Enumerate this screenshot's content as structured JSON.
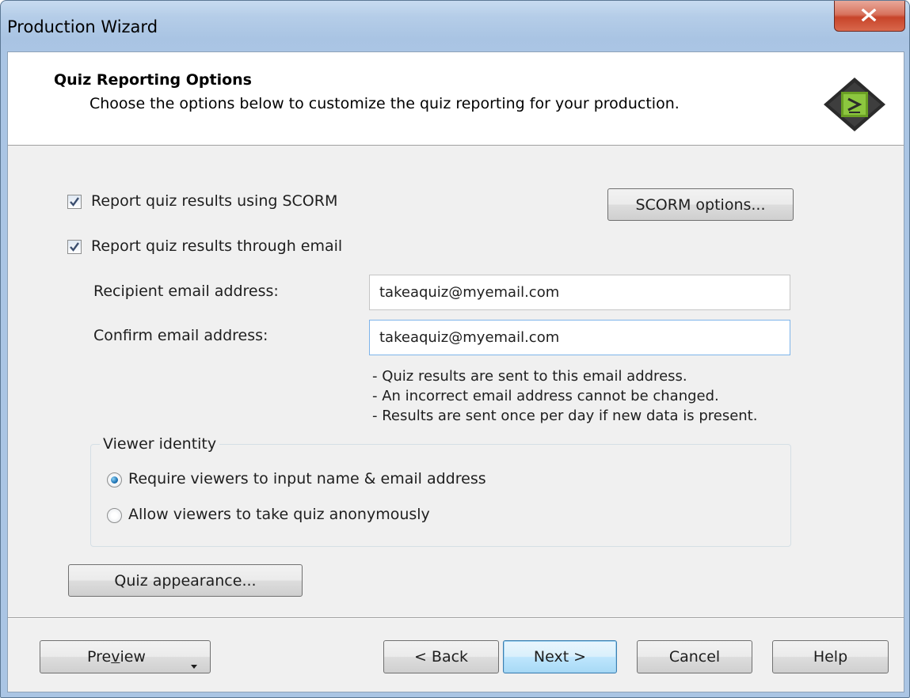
{
  "window": {
    "title": "Production Wizard"
  },
  "header": {
    "title": "Quiz Reporting Options",
    "subtitle": "Choose the options below to customize the quiz reporting for your production.",
    "logo_icon": "camtasia-logo-icon"
  },
  "scorm": {
    "label": "Report quiz results using SCORM",
    "checked": true,
    "options_button": "SCORM options..."
  },
  "email": {
    "label": "Report quiz results through email",
    "checked": true,
    "recipient_label": "Recipient email address:",
    "recipient_value": "takeaquiz@myemail.com",
    "confirm_label": "Confirm email address:",
    "confirm_value": "takeaquiz@myemail.com",
    "notes": [
      "- Quiz results are sent to this email address.",
      "- An incorrect email address cannot be changed.",
      "- Results are sent once per day if new data is present."
    ]
  },
  "viewer_identity": {
    "legend": "Viewer identity",
    "options": [
      {
        "label": "Require viewers to input name & email address",
        "selected": true
      },
      {
        "label": "Allow viewers to take quiz anonymously",
        "selected": false
      }
    ]
  },
  "quiz_appearance_button": "Quiz appearance...",
  "footer": {
    "preview_prefix": "Pre",
    "preview_underlined": "v",
    "preview_suffix": "iew",
    "back": "< Back",
    "next": "Next >",
    "cancel": "Cancel",
    "help": "Help"
  },
  "colors": {
    "accent": "#3c7fb1",
    "close_button": "#c7442a",
    "dialog_bg": "#f0f0f0"
  }
}
